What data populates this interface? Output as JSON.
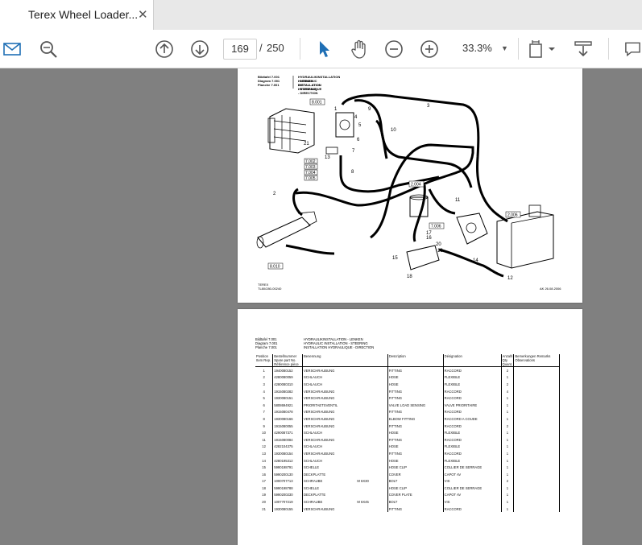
{
  "tab": {
    "title": "Terex Wheel Loader...",
    "close": "✕"
  },
  "toolbar": {
    "page_current": "169",
    "page_separator": "/",
    "page_total": "250",
    "zoom": "33.3%"
  },
  "page1": {
    "header": [
      {
        "label": "Bildtafel",
        "num": "7.001",
        "title": "HYDRAULIKINSTALLATION - LENKEN"
      },
      {
        "label": "Diagram",
        "num": "7.001",
        "title": "HYDRAULIC INSTALLATION - STEERING"
      },
      {
        "label": "Planche",
        "num": "7.001",
        "title": "INSTALLATION HYDRAULIQUE - DIRECTION"
      }
    ],
    "refs": [
      "8.001",
      "7.002",
      "7.003",
      "7.004",
      "7.005",
      "2.004",
      "7.006",
      "2.006",
      "8.010"
    ],
    "callouts": [
      "1",
      "2",
      "3",
      "4",
      "5",
      "6",
      "7",
      "8",
      "9",
      "10",
      "11",
      "12",
      "13",
      "14",
      "15",
      "16",
      "17",
      "18",
      "19",
      "20",
      "21"
    ],
    "footer_left_1": "TEREX",
    "footer_left_2": "TL80/280-00240",
    "footer_right": "AK 26.08.2006"
  },
  "page2": {
    "header": [
      {
        "label": "Bildtafel",
        "num": "7.001",
        "title": "HYDRAULIKINSTALLATION - LENKEN"
      },
      {
        "label": "Diagram",
        "num": "7.001",
        "title": "HYDRAULIC INSTALLATION - STEERING"
      },
      {
        "label": "Planche",
        "num": "7.001",
        "title": "INSTALLATION HYDRAULIQUE - DIRECTION"
      }
    ],
    "columns": [
      "Position Item Rep.",
      "Bestellnummer Spare part No. Référence pièce",
      "Benennung",
      "Description",
      "Désignation",
      "Anzahl Qty Quant.",
      "Bemerkungen Remarks Observations"
    ],
    "rows": [
      [
        "1",
        "1940080152",
        "VERSCHRAUBUNG",
        "",
        "FITTING",
        "RACCORD",
        "2"
      ],
      [
        "2",
        "4280080059",
        "SCHLAUCH",
        "",
        "HOSE",
        "FLEXIBLE",
        "1"
      ],
      [
        "3",
        "4280080310",
        "SCHLAUCH",
        "",
        "HOSE",
        "FLEXIBLE",
        "2"
      ],
      [
        "4",
        "1915080282",
        "VERSCHRAUBUNG",
        "",
        "FITTING",
        "RACCORD",
        "4"
      ],
      [
        "5",
        "1930080151",
        "VERSCHRAUBUNG",
        "",
        "FITTING",
        "RACCORD",
        "1"
      ],
      [
        "6",
        "5808694921",
        "PRIORITAETSVENTIL",
        "",
        "VALVE LOAD SENSING",
        "VALVE PRIORITAIRE",
        "1"
      ],
      [
        "7",
        "1915080478",
        "VERSCHRAUBUNG",
        "",
        "FITTING",
        "RACCORD",
        "1"
      ],
      [
        "8",
        "1930080166",
        "VERSCHRAUBUNG",
        "",
        "ELBOW FITTING",
        "RACCORD A COUDE",
        "1"
      ],
      [
        "9",
        "1915080055",
        "VERSCHRAUBUNG",
        "",
        "FITTING",
        "RACCORD",
        "2"
      ],
      [
        "10",
        "4290087371",
        "SCHLAUCH",
        "",
        "HOSE",
        "FLEXIBLE",
        "1"
      ],
      [
        "11",
        "1915080084",
        "VERSCHRAUBUNG",
        "",
        "FITTING",
        "RACCORD",
        "1"
      ],
      [
        "12",
        "4282104375",
        "SCHLAUCH",
        "",
        "HOSE",
        "FLEXIBLE",
        "1"
      ],
      [
        "13",
        "1930080154",
        "VERSCHRAUBUNG",
        "",
        "FITTING",
        "RACCORD",
        "1"
      ],
      [
        "14",
        "4280195312",
        "SCHLAUCH",
        "",
        "HOSE",
        "FLEXIBLE",
        "1"
      ],
      [
        "15",
        "5990198791",
        "SCHELLE",
        "",
        "HOSE CLIP",
        "COLLIER DE SERRAGE",
        "1"
      ],
      [
        "16",
        "5990200130",
        "DECKPLATTE",
        "",
        "COVER",
        "CAPOT AV",
        "1"
      ],
      [
        "17",
        "1000707713",
        "SCHRAUBE",
        "M 6X30",
        "BOLT",
        "VIS",
        "2"
      ],
      [
        "18",
        "5990198788",
        "SCHELLE",
        "",
        "HOSE CLIP",
        "COLLIER DE SERRAGE",
        "1"
      ],
      [
        "19",
        "5990200230",
        "DECKPLATTE",
        "",
        "COVER PLATE",
        "CAPOT AV",
        "1"
      ],
      [
        "20",
        "1007707219",
        "SCHRAUBE",
        "M 6X45",
        "BOLT",
        "VIS",
        "1"
      ],
      [
        "21",
        "1930080155",
        "VERSCHRAUBUNG",
        "",
        "FITTING",
        "RACCORD",
        "1"
      ]
    ]
  }
}
